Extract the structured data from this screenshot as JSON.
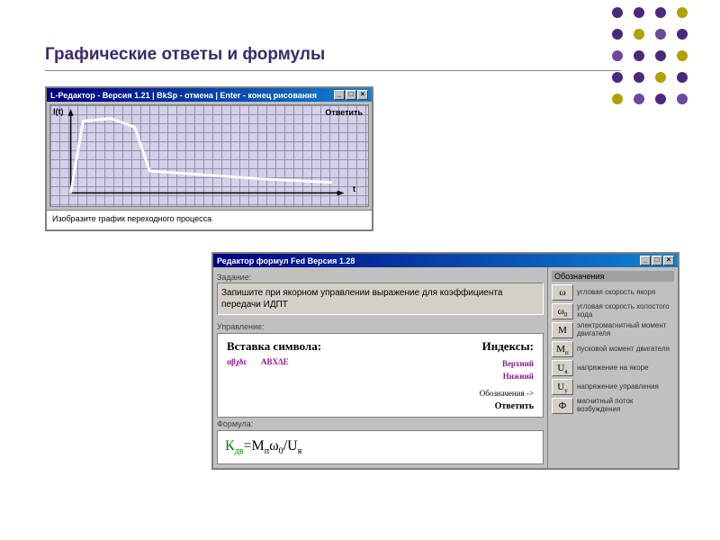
{
  "title": "Графические ответы и формулы",
  "deco_colors": [
    "#4a2a7a",
    "#4a2a7a",
    "#4a2a7a",
    "#b0a000",
    "#4a2a7a",
    "#b0a000",
    "#6a4a9a",
    "#4a2a7a",
    "#6a4a9a",
    "#4a2a7a",
    "#4a2a7a",
    "#b0a000",
    "#4a2a7a",
    "#4a2a7a",
    "#b0a000",
    "#4a2a7a",
    "#b0a000",
    "#6a4a9a",
    "#4a2a7a",
    "#6a4a9a"
  ],
  "win1": {
    "title": "L-Редактор - Версия 1.21 | BkSp - отмена | Enter - конец рисования",
    "y_axis": "I(t)",
    "x_axis": "t",
    "answer_btn": "Ответить",
    "instruction": "Изобразите график переходного процесса"
  },
  "win2": {
    "title": "Редактор формул Fed   Версия 1.28",
    "task_label": "Задание:",
    "task_text": "Запишите при якорном управлении выражение для коэффициента передачи ИДПТ",
    "controls_label": "Управление:",
    "insert_symbol_title": "Вставка символа:",
    "greek1": "αβχδε",
    "greek2": "ΑΒΧΔΕ",
    "indexes_title": "Индексы:",
    "index_top": "Верхний",
    "index_bottom": "Нижний",
    "oboz": "Обозначения ->",
    "answer_btn": "Ответить",
    "formula_label": "Формула:",
    "formula_display": "Кдв=Мпω0/Uя",
    "side_head": "Обозначения",
    "side": [
      {
        "sym": "ω",
        "desc": "угловая скорость якоря"
      },
      {
        "sym": "ω0",
        "sub": "0",
        "base": "ω",
        "desc": "угловая скорость холостого хода"
      },
      {
        "sym": "М",
        "desc": "электромагнитный момент двигателя"
      },
      {
        "sym": "Мп",
        "sub": "п",
        "base": "М",
        "desc": "пусковой момент двигателя"
      },
      {
        "sym": "Uя",
        "sub": "я",
        "base": "U",
        "desc": "напряжение на якоре"
      },
      {
        "sym": "Uу",
        "sub": "у",
        "base": "U",
        "desc": "напряжение управления"
      },
      {
        "sym": "Ф",
        "desc": "магнитный поток возбуждения"
      }
    ]
  },
  "chart_data": {
    "type": "line",
    "title": "",
    "xlabel": "t",
    "ylabel": "I(t)",
    "x": [
      0,
      0.5,
      1.5,
      2.5,
      3.0,
      7.5,
      10
    ],
    "y": [
      0,
      8.2,
      8.5,
      7.5,
      2.5,
      1.6,
      1.3
    ],
    "xlim": [
      0,
      10
    ],
    "ylim": [
      0,
      10
    ]
  }
}
